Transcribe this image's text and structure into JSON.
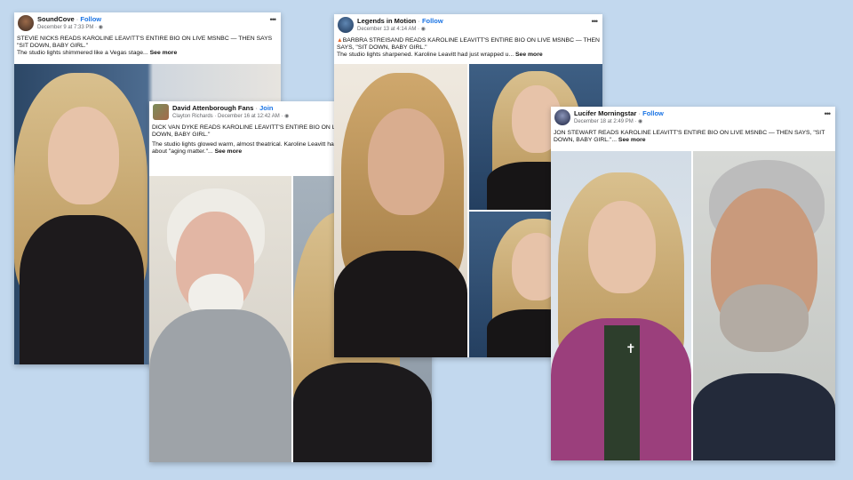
{
  "posts": [
    {
      "page": "SoundCove",
      "follow": "Follow",
      "date": "December 9 at 7:33 PM",
      "headline": "STEVIE NICKS READS KAROLINE LEAVITT'S ENTIRE BIO ON LIVE MSNBC — THEN SAYS \"SIT DOWN, BABY GIRL.\"",
      "body": "The studio lights shimmered like a Vegas stage...",
      "see_more": "See more"
    },
    {
      "page": "David Attenborough Fans",
      "follow": "Join",
      "author": "Clayton Richards",
      "date": "December 16 at 12:42 AM",
      "headline": "DICK VAN DYKE READS KAROLINE LEAVITT'S ENTIRE BIO ON LIVE MSNBC — THEN SAYS, \"SIT DOWN, BABY GIRL.\"",
      "body": "The studio lights glowed warm, almost theatrical. Karoline Leavitt had just wrapped her sharp tirade about \"aging matter.\"...",
      "see_more": "See more"
    },
    {
      "page": "Legends in Motion",
      "follow": "Follow",
      "date": "December 13 at 4:14 AM",
      "headline": "BARBRA STREISAND READS KAROLINE LEAVITT'S ENTIRE BIO ON LIVE MSNBC — THEN SAYS, \"SIT DOWN, BABY GIRL.\"",
      "body": "The studio lights sharpened. Karoline Leavitt had just wrapped u...",
      "see_more": "See more"
    },
    {
      "page": "Lucifer Morningstar",
      "follow": "Follow",
      "date": "December 18 at 2:49 PM",
      "headline": "JON STEWART READS KAROLINE LEAVITT'S ENTIRE BIO ON LIVE MSNBC — THEN SAYS, \"SIT DOWN, BABY GIRL.\"...",
      "see_more": "See more"
    }
  ],
  "icons": {
    "more": "more-options-icon",
    "globe": "globe-icon"
  },
  "colors": {
    "background": "#c2d8ee",
    "link_blue": "#1b74e4"
  }
}
